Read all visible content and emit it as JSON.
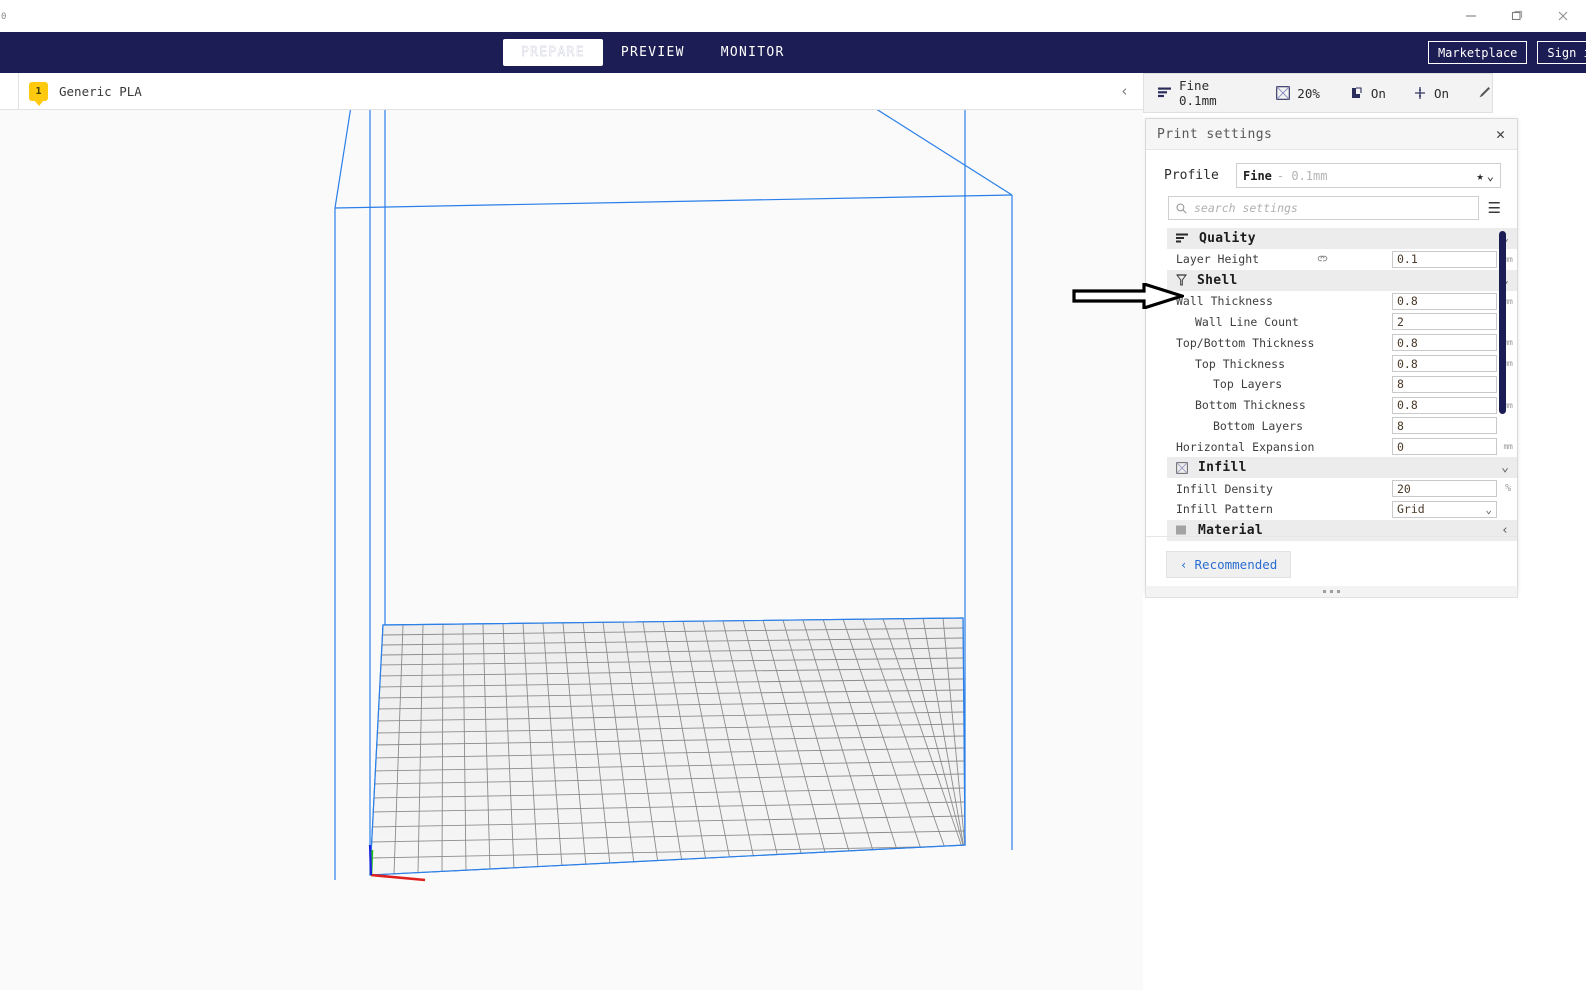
{
  "window": {
    "edge_char": "0",
    "controls": [
      {
        "name": "minimize",
        "glyph": "minimize-icon"
      },
      {
        "name": "maximize",
        "glyph": "maximize-icon"
      },
      {
        "name": "close",
        "glyph": "close-icon"
      }
    ]
  },
  "topnav": {
    "tabs": [
      {
        "label": "PREPARE",
        "active": true
      },
      {
        "label": "PREVIEW",
        "active": false
      },
      {
        "label": "MONITOR",
        "active": false
      }
    ],
    "marketplace_label": "Marketplace",
    "signin_label": "Sign in",
    "background_color": "#1b1d54"
  },
  "subbar": {
    "extruder_number": "1",
    "material_name": "Generic PLA",
    "collapse_icon": "chevron-left-icon"
  },
  "setup_bar": {
    "profile_label": "Fine  0.1mm",
    "infill_label": "20%",
    "support_label": "On",
    "adhesion_label": "On",
    "edit_icon": "pencil-icon"
  },
  "panel": {
    "title": "Print settings",
    "close_label": "✕",
    "profile": {
      "label": "Profile",
      "value_name": "Fine",
      "value_sub": "- 0.1mm",
      "star_icon": "star-icon",
      "chevron_icon": "chevron-down-icon"
    },
    "search": {
      "placeholder": "search settings",
      "icon": "search-icon",
      "menu_icon": "hamburger-icon"
    },
    "sections": [
      {
        "name": "Quality",
        "icon": "quality-layers-icon",
        "chevron": "chevron-down-icon",
        "rows": [
          {
            "label": "Layer Height",
            "indent": 0,
            "value": "0.1",
            "unit": "mm",
            "link": true,
            "type": "text"
          }
        ]
      },
      {
        "name": "Shell",
        "icon": "shell-funnel-icon",
        "chevron": "chevron-down-icon",
        "rows": [
          {
            "label": "Wall Thickness",
            "indent": 0,
            "value": "0.8",
            "unit": "mm",
            "link": false,
            "type": "text"
          },
          {
            "label": "Wall Line Count",
            "indent": 1,
            "value": "2",
            "unit": "",
            "link": false,
            "type": "text"
          },
          {
            "label": "Top/Bottom Thickness",
            "indent": 0,
            "value": "0.8",
            "unit": "mm",
            "link": false,
            "type": "text"
          },
          {
            "label": "Top Thickness",
            "indent": 1,
            "value": "0.8",
            "unit": "mm",
            "link": false,
            "type": "text"
          },
          {
            "label": "Top Layers",
            "indent": 2,
            "value": "8",
            "unit": "",
            "link": false,
            "type": "text"
          },
          {
            "label": "Bottom Thickness",
            "indent": 1,
            "value": "0.8",
            "unit": "mm",
            "link": false,
            "type": "text"
          },
          {
            "label": "Bottom Layers",
            "indent": 2,
            "value": "8",
            "unit": "",
            "link": false,
            "type": "text"
          },
          {
            "label": "Horizontal Expansion",
            "indent": 0,
            "value": "0",
            "unit": "mm",
            "link": false,
            "type": "text"
          }
        ]
      },
      {
        "name": "Infill",
        "icon": "infill-grid-icon",
        "chevron": "chevron-down-icon",
        "rows": [
          {
            "label": "Infill Density",
            "indent": 0,
            "value": "20",
            "unit": "%",
            "link": false,
            "type": "text"
          },
          {
            "label": "Infill Pattern",
            "indent": 0,
            "value": "Grid",
            "unit": "",
            "link": false,
            "type": "select"
          }
        ]
      },
      {
        "name": "Material",
        "icon": "material-spool-icon",
        "chevron": "chevron-left-icon",
        "rows": []
      }
    ],
    "footer": {
      "recommended_label": "Recommended",
      "back_icon": "chevron-left-icon"
    },
    "scrollbar_color": "#1b1d54"
  },
  "viewport": {
    "buildplate_outline_color": "#2a7fe8",
    "grid_line_color": "#8c8c8c",
    "axis_x_color": "#e02020",
    "axis_y_color": "#20c020",
    "axis_z_color": "#2020e0"
  },
  "annotation": {
    "arrow": "right-arrow-annotation",
    "points_at": "Wall Thickness"
  }
}
